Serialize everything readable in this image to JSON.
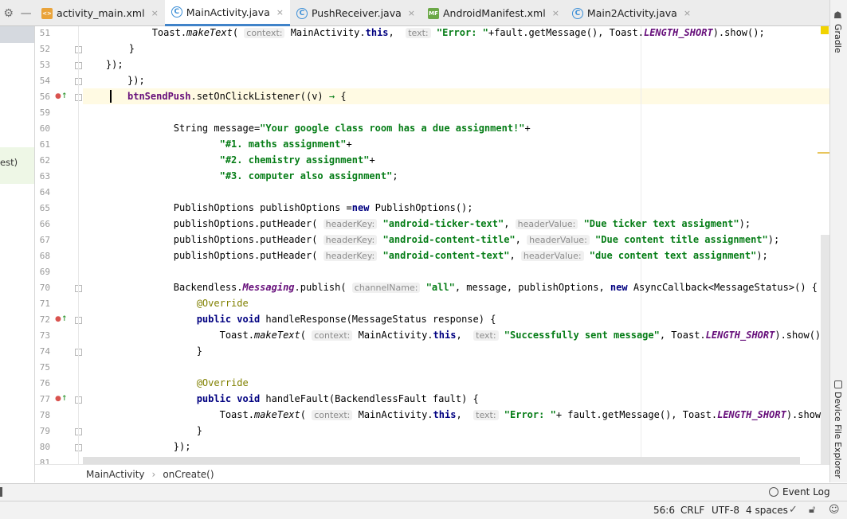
{
  "tabs": [
    {
      "name": "activity_main.xml",
      "kind": "xml",
      "icon": "<>",
      "active": false
    },
    {
      "name": "MainActivity.java",
      "kind": "java",
      "icon": "C",
      "active": true
    },
    {
      "name": "PushReceiver.java",
      "kind": "java",
      "icon": "C",
      "active": false
    },
    {
      "name": "AndroidManifest.xml",
      "kind": "manifest",
      "icon": "MF",
      "active": false
    },
    {
      "name": "Main2Activity.java",
      "kind": "java",
      "icon": "C",
      "active": false
    }
  ],
  "tab_close_glyph": "×",
  "left_panel": {
    "partial_text": "est)"
  },
  "gutter": {
    "line_numbers": [
      "51",
      "52",
      "53",
      "54",
      "56",
      "59",
      "60",
      "61",
      "62",
      "63",
      "64",
      "65",
      "66",
      "67",
      "68",
      "69",
      "70",
      "71",
      "72",
      "73",
      "74",
      "75",
      "76",
      "77",
      "78",
      "79",
      "80",
      "81"
    ],
    "override_markers": [
      "56",
      "72",
      "77"
    ]
  },
  "code": {
    "l51": {
      "pre": "            Toast.",
      "m": "makeText",
      "p1": "( ",
      "h1": "context:",
      "s1": " MainActivity.",
      "k1": "this",
      "s2": ",  ",
      "h2": "text:",
      "s3": " ",
      "str": "\"Error: \"",
      "s4": "+fault.getMessage(), Toast.",
      "c": "LENGTH_SHORT",
      "s5": ").show();"
    },
    "l52": "        }",
    "l53": "    });",
    "l54": "});",
    "l56": {
      "field": "btnSendPush",
      "mid": ".setOnClickListener((v) ",
      "arrow": "→",
      "brace": " {"
    },
    "l60": {
      "pre": "        String message=",
      "str": "\"Your google class room has a due assignment!\"",
      "post": "+"
    },
    "l61": {
      "pre": "                ",
      "str": "\"#1. maths assignment\"",
      "post": "+"
    },
    "l62": {
      "pre": "                ",
      "str": "\"#2. chemistry assignment\"",
      "post": "+"
    },
    "l63": {
      "pre": "                ",
      "str": "\"#3. computer also assignment\"",
      "post": ";"
    },
    "l65": {
      "pre": "        PublishOptions publishOptions =",
      "kw": "new",
      "post": " PublishOptions();"
    },
    "l66": {
      "pre": "        publishOptions.putHeader( ",
      "h1": "headerKey:",
      "s1": " ",
      "k": "\"android-ticker-text\"",
      "s2": ", ",
      "h2": "headerValue:",
      "s3": " ",
      "v": "\"Due ticker text assigment\"",
      "end": ");"
    },
    "l67": {
      "pre": "        publishOptions.putHeader( ",
      "h1": "headerKey:",
      "s1": " ",
      "k": "\"android-content-title\"",
      "s2": ", ",
      "h2": "headerValue:",
      "s3": " ",
      "v": "\"Due content title assignment\"",
      "end": ");"
    },
    "l68": {
      "pre": "        publishOptions.putHeader( ",
      "h1": "headerKey:",
      "s1": " ",
      "k": "\"android-content-text\"",
      "s2": ", ",
      "h2": "headerValue:",
      "s3": " ",
      "v": "\"due content text assignment\"",
      "end": ");"
    },
    "l70": {
      "pre": "        Backendless.",
      "m": "Messaging",
      "s1": ".publish( ",
      "h": "channelName:",
      "s2": " ",
      "str": "\"all\"",
      "s3": ", message, publishOptions, ",
      "kw": "new",
      "s4": " AsyncCallback<MessageStatus>() {"
    },
    "l71": "            @Override",
    "l72": {
      "pre": "            ",
      "k1": "public",
      "s1": " ",
      "k2": "void",
      "post": " handleResponse(MessageStatus response) {"
    },
    "l73": {
      "pre": "                Toast.",
      "m": "makeText",
      "p1": "( ",
      "h1": "context:",
      "s1": " MainActivity.",
      "k1": "this",
      "s2": ",  ",
      "h2": "text:",
      "s3": " ",
      "str": "\"Successfully sent message\"",
      "s4": ", Toast.",
      "c": "LENGTH_SHORT",
      "s5": ").show();"
    },
    "l74": "            }",
    "l76": "            @Override",
    "l77": {
      "pre": "            ",
      "k1": "public",
      "s1": " ",
      "k2": "void",
      "post": " handleFault(BackendlessFault fault) {"
    },
    "l78": {
      "pre": "                Toast.",
      "m": "makeText",
      "p1": "( ",
      "h1": "context:",
      "s1": " MainActivity.",
      "k1": "this",
      "s2": ",  ",
      "h2": "text:",
      "s3": " ",
      "str": "\"Error: \"",
      "s4": "+ fault.getMessage(), Toast.",
      "c": "LENGTH_SHORT",
      "s5": ").show();"
    },
    "l79": "            }",
    "l80": "        });"
  },
  "breadcrumb": {
    "class_name": "MainActivity",
    "separator": "›",
    "method": "onCreate()"
  },
  "right_strip": {
    "gradle": "Gradle",
    "device_explorer": "Device File Explorer"
  },
  "toolbar": {
    "event_log": "Event Log"
  },
  "status": {
    "position": "56:6",
    "line_sep": "CRLF",
    "encoding": "UTF-8",
    "indent": "4 spaces"
  },
  "colors": {
    "keyword": "#000080",
    "string": "#067d17",
    "field": "#660e7a",
    "annotation": "#808000",
    "caret_line": "#fffae3",
    "active_tab": "#4083c9"
  }
}
